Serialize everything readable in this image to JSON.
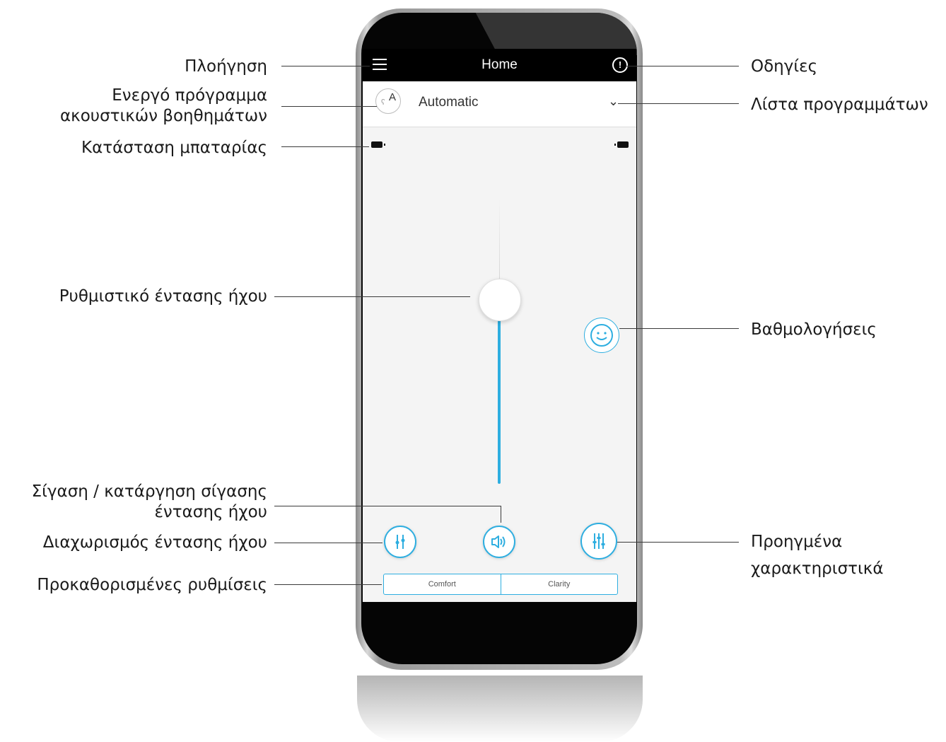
{
  "screen": {
    "title": "Home",
    "program": {
      "name": "Automatic",
      "icon": "hearing-aid-program-icon",
      "icon_letter": "A"
    },
    "menu_icon": "hamburger-menu-icon",
    "info_icon": "exclamation-circle-icon",
    "dropdown_icon": "chevron-down-icon",
    "presets": [
      "Comfort",
      "Clarity"
    ],
    "volume_level": 0.62,
    "accent_color": "#2eaee0"
  },
  "callouts": {
    "navigation": "Πλοήγηση",
    "active_program_line1": "Ενεργό πρόγραμμα",
    "active_program_line2": "ακουστικών βοηθημάτων",
    "battery": "Κατάσταση μπαταρίας",
    "volume_slider": "Ρυθμιστικό έντασης ήχου",
    "mute_line1": "Σίγαση / κατάργηση σίγασης",
    "mute_line2": "έντασης ήχου",
    "split_volume": "Διαχωρισμός έντασης ήχου",
    "presets": "Προκαθορισμένες ρυθμίσεις",
    "instructions": "Οδηγίες",
    "program_list": "Λίστα προγραμμάτων",
    "ratings": "Βαθμολογήσεις",
    "advanced_line1": "Προηγμένα",
    "advanced_line2": "χαρακτηριστικά"
  }
}
